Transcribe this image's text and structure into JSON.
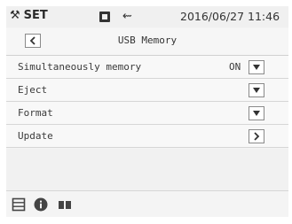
{
  "status_bar": {
    "mode_label": "SET",
    "datetime": "2016/06/27 11:46",
    "icons": [
      "wrench-icon",
      "sd-card-icon",
      "usb-icon"
    ]
  },
  "title_bar": {
    "title": "USB Memory",
    "back_icon": "chevron-left-icon"
  },
  "rows": [
    {
      "label": "Simultaneously memory",
      "value": "ON",
      "control_icon": "dropdown-arrow-icon"
    },
    {
      "label": "Eject",
      "value": "",
      "control_icon": "dropdown-arrow-icon"
    },
    {
      "label": "Format",
      "value": "",
      "control_icon": "dropdown-arrow-icon"
    },
    {
      "label": "Update",
      "value": "",
      "control_icon": "chevron-right-icon"
    }
  ],
  "bottom_bar": {
    "icons": [
      "list-icon",
      "info-icon",
      "pause-icon"
    ]
  }
}
